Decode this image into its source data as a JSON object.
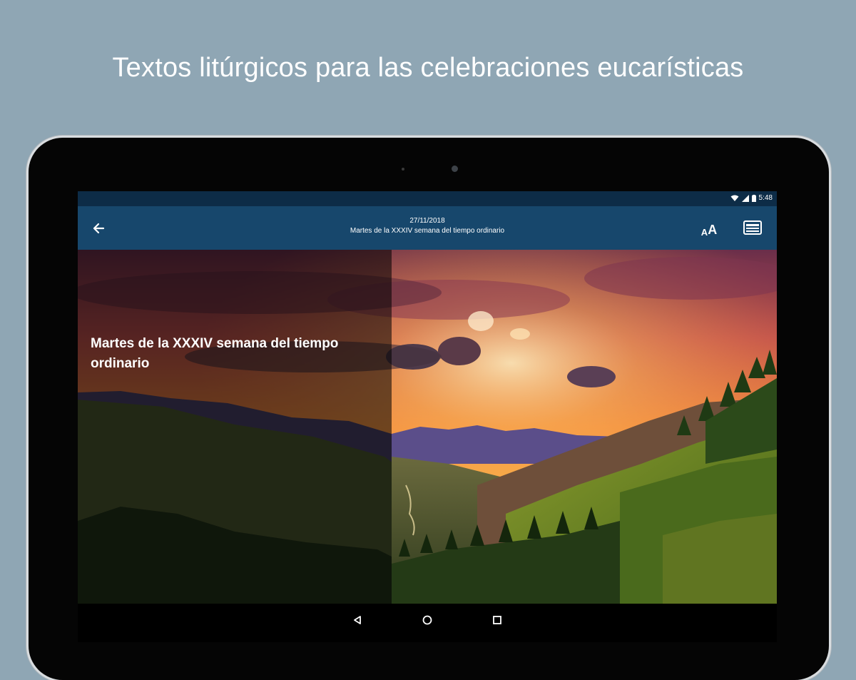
{
  "headline": "Textos litúrgicos para las celebraciones eucarísticas",
  "status_bar": {
    "time": "5:48",
    "icons": [
      "wifi-icon",
      "signal-icon",
      "battery-icon"
    ]
  },
  "app_bar": {
    "back_icon": "arrow-back-icon",
    "date": "27/11/2018",
    "subtitle": "Martes de la XXXIV semana del tiempo ordinario",
    "font_size_label_small": "A",
    "font_size_label_big": "A",
    "reader_icon": "book-icon"
  },
  "content": {
    "title": "Martes de la XXXIV semana del tiempo ordinario",
    "image": "mountain-sunset-landscape"
  },
  "nav_bar": {
    "icons": [
      "back-triangle-icon",
      "home-circle-icon",
      "recents-square-icon"
    ]
  },
  "colors": {
    "background": "#8fa6b4",
    "status_bar": "#0d2c47",
    "app_bar": "#17476c"
  }
}
